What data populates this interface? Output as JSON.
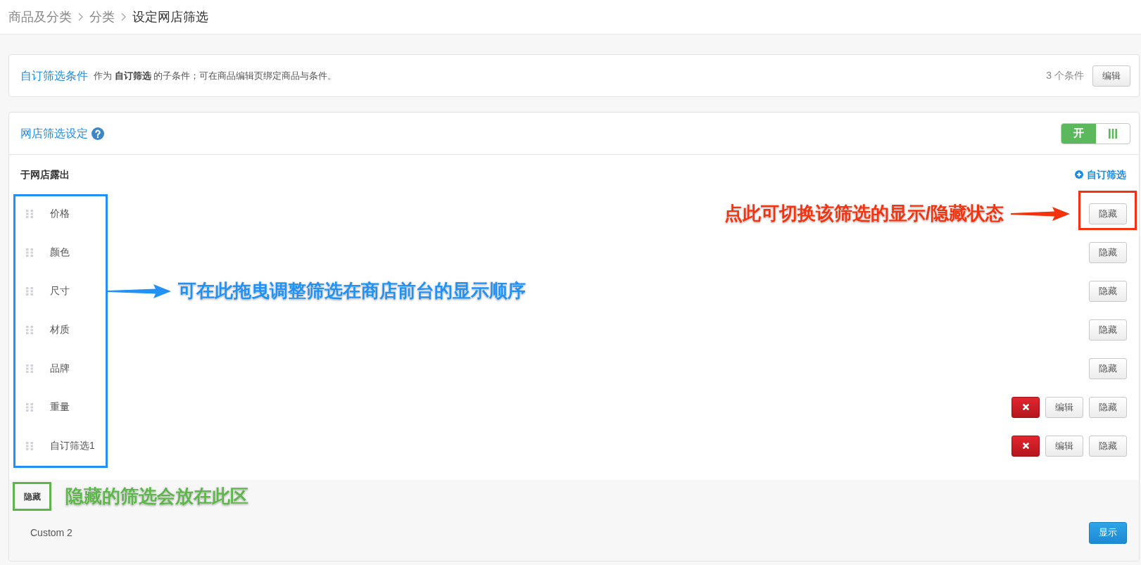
{
  "breadcrumb": [
    {
      "label": "商品及分类",
      "current": false
    },
    {
      "label": "分类",
      "current": false
    },
    {
      "label": "设定网店筛选",
      "current": true
    }
  ],
  "conditions_card": {
    "title": "自订筛选条件",
    "description": "作为 **自订筛选** 的子条件；可在商品编辑页绑定商品与条件。",
    "count": "3 个条件",
    "edit_button": "编辑"
  },
  "filter_settings": {
    "title": "网店筛选设定",
    "toggle": {
      "on_label": "开",
      "on": true
    },
    "shown_section": {
      "title": "于网店露出",
      "add_link": "自订筛选",
      "filters": [
        {
          "kind": "builtin",
          "label": "价格",
          "hide_button": "隐藏"
        },
        {
          "kind": "builtin",
          "label": "颜色",
          "hide_button": "隐藏"
        },
        {
          "kind": "builtin",
          "label": "尺寸",
          "hide_button": "隐藏"
        },
        {
          "kind": "builtin",
          "label": "材质",
          "hide_button": "隐藏"
        },
        {
          "kind": "builtin",
          "label": "品牌",
          "hide_button": "隐藏"
        },
        {
          "kind": "custom",
          "label": "重量",
          "edit_button": "编辑",
          "hide_button": "隐藏"
        },
        {
          "kind": "custom",
          "label": "自订筛选1",
          "edit_button": "编辑",
          "hide_button": "隐藏"
        }
      ]
    },
    "hidden_section": {
      "title": "隐藏",
      "filters": [
        {
          "label": "Custom 2",
          "show_button": "显示"
        }
      ]
    }
  },
  "annotations": [
    {
      "kind": "reorder_hint",
      "text": "可在此拖曳调整筛选在商店前台的显示顺序",
      "color": "#2191f5"
    },
    {
      "kind": "visibility_hint",
      "text": "点此可切换该筛选的显示/隐藏状态",
      "color": "#f4320e"
    },
    {
      "kind": "hidden_area_hint",
      "text": "隐藏的筛选会放在此区",
      "color": "#5eb54c"
    }
  ]
}
